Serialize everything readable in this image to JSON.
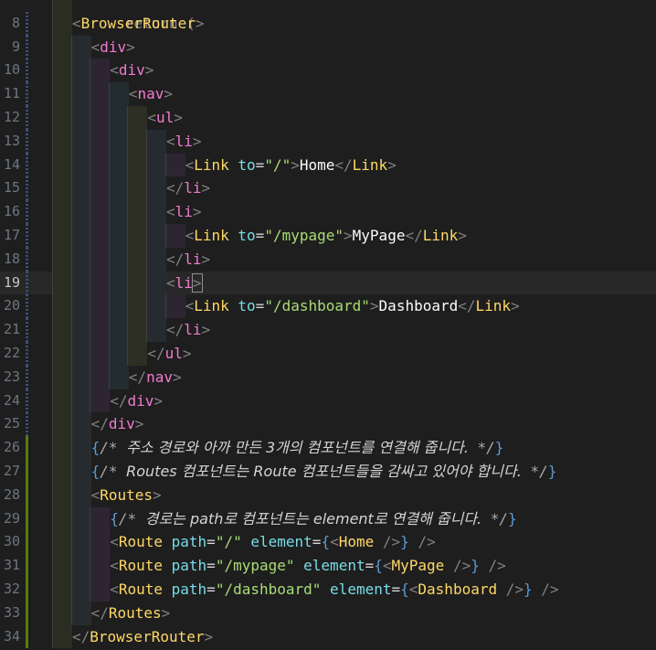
{
  "editor": {
    "first_partial_line": "return (",
    "active_line": 19,
    "lines": [
      {
        "num": "8",
        "mod": "dashed",
        "indent": 1,
        "tokens": [
          [
            "brk",
            "<"
          ],
          [
            "tn-y",
            "BrowserRouter"
          ],
          [
            "brk",
            ">"
          ]
        ]
      },
      {
        "num": "9",
        "mod": "dashed",
        "indent": 2,
        "tokens": [
          [
            "brk",
            "<"
          ],
          [
            "tn-p",
            "div"
          ],
          [
            "brk",
            ">"
          ]
        ]
      },
      {
        "num": "10",
        "mod": "dashed",
        "indent": 3,
        "tokens": [
          [
            "brk",
            "<"
          ],
          [
            "tn-p",
            "div"
          ],
          [
            "brk",
            ">"
          ]
        ]
      },
      {
        "num": "11",
        "mod": "dashed",
        "indent": 4,
        "tokens": [
          [
            "brk",
            "<"
          ],
          [
            "tn-p",
            "nav"
          ],
          [
            "brk",
            ">"
          ]
        ]
      },
      {
        "num": "12",
        "mod": "dashed",
        "indent": 5,
        "tokens": [
          [
            "brk",
            "<"
          ],
          [
            "tn-p",
            "ul"
          ],
          [
            "brk",
            ">"
          ]
        ]
      },
      {
        "num": "13",
        "mod": "dashed",
        "indent": 6,
        "tokens": [
          [
            "brk",
            "<"
          ],
          [
            "tn-p",
            "li"
          ],
          [
            "brk",
            ">"
          ]
        ]
      },
      {
        "num": "14",
        "mod": "dashed",
        "indent": 7,
        "tokens": [
          [
            "brk",
            "<"
          ],
          [
            "tn-y",
            "Link"
          ],
          [
            "txt",
            " "
          ],
          [
            "attr",
            "to"
          ],
          [
            "op",
            "="
          ],
          [
            "str",
            "\"/\""
          ],
          [
            "brk",
            ">"
          ],
          [
            "txt",
            "Home"
          ],
          [
            "brk",
            "</"
          ],
          [
            "tn-y",
            "Link"
          ],
          [
            "brk",
            ">"
          ]
        ]
      },
      {
        "num": "15",
        "mod": "dashed",
        "indent": 6,
        "tokens": [
          [
            "brk",
            "</"
          ],
          [
            "tn-p",
            "li"
          ],
          [
            "brk",
            ">"
          ]
        ]
      },
      {
        "num": "16",
        "mod": "dashed",
        "indent": 6,
        "tokens": [
          [
            "brk",
            "<"
          ],
          [
            "tn-p",
            "li"
          ],
          [
            "brk",
            ">"
          ]
        ]
      },
      {
        "num": "17",
        "mod": "dashed",
        "indent": 7,
        "tokens": [
          [
            "brk",
            "<"
          ],
          [
            "tn-y",
            "Link"
          ],
          [
            "txt",
            " "
          ],
          [
            "attr",
            "to"
          ],
          [
            "op",
            "="
          ],
          [
            "str",
            "\"/mypage\""
          ],
          [
            "brk",
            ">"
          ],
          [
            "txt",
            "MyPage"
          ],
          [
            "brk",
            "</"
          ],
          [
            "tn-y",
            "Link"
          ],
          [
            "brk",
            ">"
          ]
        ]
      },
      {
        "num": "18",
        "mod": "dashed",
        "indent": 6,
        "tokens": [
          [
            "brk",
            "</"
          ],
          [
            "tn-p",
            "li"
          ],
          [
            "brk",
            ">"
          ]
        ]
      },
      {
        "num": "19",
        "mod": "dashed",
        "indent": 6,
        "tokens": [
          [
            "brk",
            "<"
          ],
          [
            "tn-p",
            "li"
          ],
          [
            "brk",
            ">"
          ]
        ]
      },
      {
        "num": "20",
        "mod": "dashed",
        "indent": 7,
        "tokens": [
          [
            "brk",
            "<"
          ],
          [
            "tn-y",
            "Link"
          ],
          [
            "txt",
            " "
          ],
          [
            "attr",
            "to"
          ],
          [
            "op",
            "="
          ],
          [
            "str",
            "\"/dashboard\""
          ],
          [
            "brk",
            ">"
          ],
          [
            "txt",
            "Dashboard"
          ],
          [
            "brk",
            "</"
          ],
          [
            "tn-y",
            "Link"
          ],
          [
            "brk",
            ">"
          ]
        ]
      },
      {
        "num": "21",
        "mod": "dashed",
        "indent": 6,
        "tokens": [
          [
            "brk",
            "</"
          ],
          [
            "tn-p",
            "li"
          ],
          [
            "brk",
            ">"
          ]
        ]
      },
      {
        "num": "22",
        "mod": "dashed",
        "indent": 5,
        "tokens": [
          [
            "brk",
            "</"
          ],
          [
            "tn-p",
            "ul"
          ],
          [
            "brk",
            ">"
          ]
        ]
      },
      {
        "num": "23",
        "mod": "dashed",
        "indent": 4,
        "tokens": [
          [
            "brk",
            "</"
          ],
          [
            "tn-p",
            "nav"
          ],
          [
            "brk",
            ">"
          ]
        ]
      },
      {
        "num": "24",
        "mod": "dashed",
        "indent": 3,
        "tokens": [
          [
            "brk",
            "</"
          ],
          [
            "tn-p",
            "div"
          ],
          [
            "brk",
            ">"
          ]
        ]
      },
      {
        "num": "25",
        "mod": "dashed",
        "indent": 2,
        "tokens": [
          [
            "brk",
            "</"
          ],
          [
            "tn-p",
            "div"
          ],
          [
            "brk",
            ">"
          ]
        ]
      },
      {
        "num": "26",
        "mod": "added",
        "indent": 2,
        "tokens": [
          [
            "curly",
            "{"
          ],
          [
            "cm",
            "/* "
          ],
          [
            "cm-kr",
            "주소 경로와 아까 만든 3개의 컴포넌트를 연결해 줍니다."
          ],
          [
            "cm",
            " */"
          ],
          [
            "curly",
            "}"
          ]
        ]
      },
      {
        "num": "27",
        "mod": "added",
        "indent": 2,
        "tokens": [
          [
            "curly",
            "{"
          ],
          [
            "cm",
            "/* "
          ],
          [
            "cm-kr",
            "Routes 컴포넌트는 Route 컴포넌트들을 감싸고 있어야 합니다."
          ],
          [
            "cm",
            " */"
          ],
          [
            "curly",
            "}"
          ]
        ]
      },
      {
        "num": "28",
        "mod": "added",
        "indent": 2,
        "tokens": [
          [
            "brk",
            "<"
          ],
          [
            "tn-y",
            "Routes"
          ],
          [
            "brk",
            ">"
          ]
        ]
      },
      {
        "num": "29",
        "mod": "added",
        "indent": 3,
        "tokens": [
          [
            "curly",
            "{"
          ],
          [
            "cm",
            "/* "
          ],
          [
            "cm-kr",
            "경로는 path로 컴포넌트는 element로 연결해 줍니다."
          ],
          [
            "cm",
            " */"
          ],
          [
            "curly",
            "}"
          ]
        ]
      },
      {
        "num": "30",
        "mod": "added",
        "indent": 3,
        "tokens": [
          [
            "brk",
            "<"
          ],
          [
            "tn-y",
            "Route"
          ],
          [
            "txt",
            " "
          ],
          [
            "attr",
            "path"
          ],
          [
            "op",
            "="
          ],
          [
            "str",
            "\"/\""
          ],
          [
            "txt",
            " "
          ],
          [
            "attr",
            "element"
          ],
          [
            "op",
            "="
          ],
          [
            "curly",
            "{"
          ],
          [
            "brk",
            "<"
          ],
          [
            "tn-y",
            "Home"
          ],
          [
            "txt",
            " "
          ],
          [
            "brk",
            "/>"
          ],
          [
            "curly",
            "}"
          ],
          [
            "txt",
            " "
          ],
          [
            "brk",
            "/>"
          ]
        ]
      },
      {
        "num": "31",
        "mod": "added",
        "indent": 3,
        "tokens": [
          [
            "brk",
            "<"
          ],
          [
            "tn-y",
            "Route"
          ],
          [
            "txt",
            " "
          ],
          [
            "attr",
            "path"
          ],
          [
            "op",
            "="
          ],
          [
            "str",
            "\"/mypage\""
          ],
          [
            "txt",
            " "
          ],
          [
            "attr",
            "element"
          ],
          [
            "op",
            "="
          ],
          [
            "curly",
            "{"
          ],
          [
            "brk",
            "<"
          ],
          [
            "tn-y",
            "MyPage"
          ],
          [
            "txt",
            " "
          ],
          [
            "brk",
            "/>"
          ],
          [
            "curly",
            "}"
          ],
          [
            "txt",
            " "
          ],
          [
            "brk",
            "/>"
          ]
        ]
      },
      {
        "num": "32",
        "mod": "added",
        "indent": 3,
        "tokens": [
          [
            "brk",
            "<"
          ],
          [
            "tn-y",
            "Route"
          ],
          [
            "txt",
            " "
          ],
          [
            "attr",
            "path"
          ],
          [
            "op",
            "="
          ],
          [
            "str",
            "\"/dashboard\""
          ],
          [
            "txt",
            " "
          ],
          [
            "attr",
            "element"
          ],
          [
            "op",
            "="
          ],
          [
            "curly",
            "{"
          ],
          [
            "brk",
            "<"
          ],
          [
            "tn-y",
            "Dashboard"
          ],
          [
            "txt",
            " "
          ],
          [
            "brk",
            "/>"
          ],
          [
            "curly",
            "}"
          ],
          [
            "txt",
            " "
          ],
          [
            "brk",
            "/>"
          ]
        ]
      },
      {
        "num": "33",
        "mod": "added",
        "indent": 2,
        "tokens": [
          [
            "brk",
            "</"
          ],
          [
            "tn-y",
            "Routes"
          ],
          [
            "brk",
            ">"
          ]
        ]
      },
      {
        "num": "34",
        "mod": "added",
        "indent": 1,
        "tokens": [
          [
            "brk",
            "</"
          ],
          [
            "tn-y",
            "BrowserRouter"
          ],
          [
            "brk",
            ">"
          ]
        ]
      }
    ]
  },
  "colors": {
    "background": "#1e1e1e",
    "tag_bracket": "#808080",
    "component_tag": "#ffd866",
    "html_tag": "#f07bd0",
    "attribute": "#78dce8",
    "string": "#a9dc76",
    "comment": "#aaaaaa",
    "added_line_marker": "#587c0c"
  }
}
